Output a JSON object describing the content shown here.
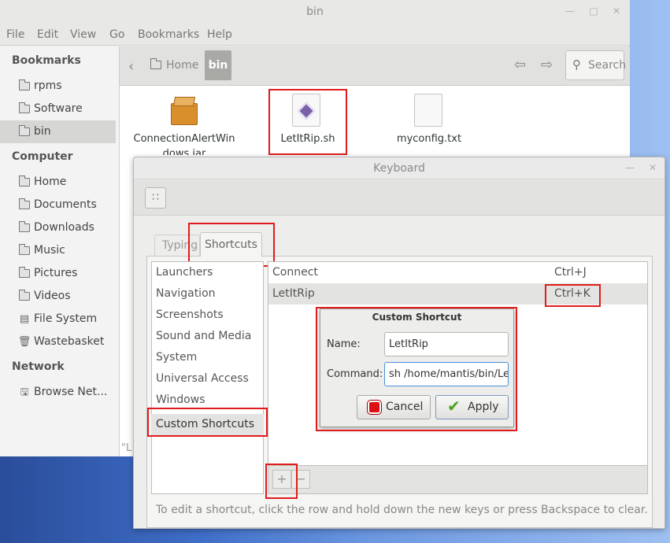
{
  "file_manager": {
    "title": "bin",
    "menu": [
      "File",
      "Edit",
      "View",
      "Go",
      "Bookmarks",
      "Help"
    ],
    "sidebar": {
      "bookmarks_heading": "Bookmarks",
      "bookmarks": [
        "rpms",
        "Software",
        "bin"
      ],
      "computer_heading": "Computer",
      "computer": [
        "Home",
        "Documents",
        "Downloads",
        "Music",
        "Pictures",
        "Videos",
        "File System",
        "Wastebasket"
      ],
      "network_heading": "Network",
      "network": [
        "Browse Net..."
      ]
    },
    "breadcrumb": {
      "home": "Home",
      "current": "bin"
    },
    "search_label": "Search",
    "files": [
      "ConnectionAlertWin",
      "LetItRip.sh",
      "myconfig.txt"
    ],
    "file_overflow": "dows.jar",
    "status_fragment": "\"L"
  },
  "keyboard": {
    "title": "Keyboard",
    "tabs": [
      "Typing",
      "Shortcuts"
    ],
    "categories": [
      "Launchers",
      "Navigation",
      "Screenshots",
      "Sound and Media",
      "System",
      "Universal Access",
      "Windows",
      "Custom Shortcuts"
    ],
    "shortcuts": [
      {
        "name": "Connect",
        "accel": "Ctrl+J"
      },
      {
        "name": "LetItRip",
        "accel": "Ctrl+K"
      }
    ],
    "add_symbol": "+",
    "remove_symbol": "−",
    "hint": "To edit a shortcut, click the row and hold down the new keys or press Backspace to clear."
  },
  "dialog": {
    "title": "Custom Shortcut",
    "name_label": "Name:",
    "name_value": "LetItRip",
    "command_label": "Command:",
    "command_value": "sh /home/mantis/bin/Le",
    "cancel_label": "Cancel",
    "apply_label": "Apply"
  },
  "colors": {
    "highlight_box": "#e01b1b",
    "selected_row": "#e3e3e1",
    "desktop": "#3f6ec8"
  }
}
